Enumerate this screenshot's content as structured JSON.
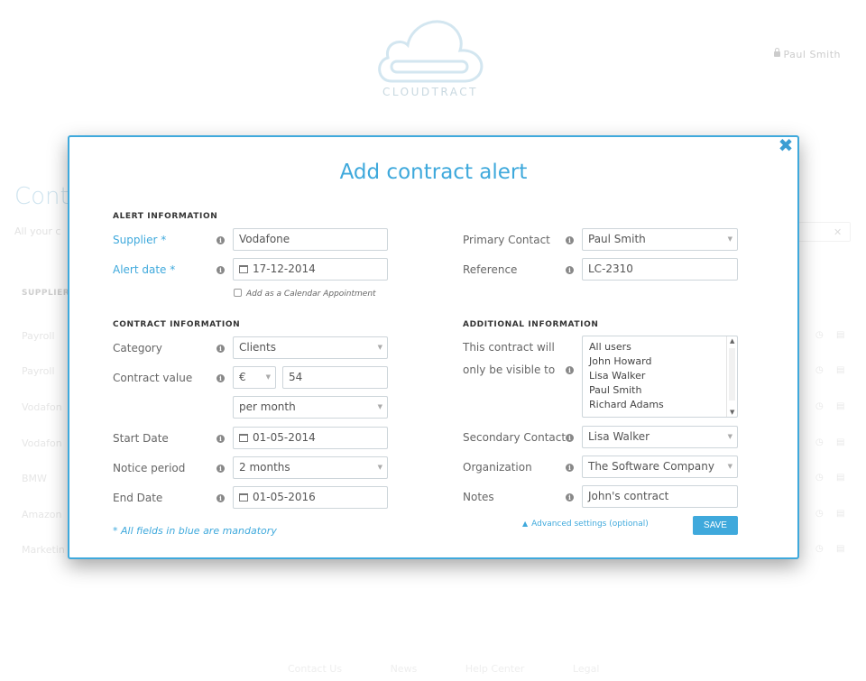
{
  "app": {
    "name": "CLOUDTRACT",
    "user": "Paul Smith"
  },
  "background": {
    "page_title": "Cont",
    "page_sub": "All your c",
    "column": "SUPPLIER",
    "rows": [
      "Payroll",
      "Payroll",
      "Vodafon",
      "Vodafon",
      "BMW",
      "Amazon",
      "Marketin"
    ],
    "footer": [
      "Contact Us",
      "News",
      "Help Center",
      "Legal"
    ]
  },
  "modal": {
    "title": "Add contract alert",
    "sections": {
      "alert": "ALERT INFORMATION",
      "contract": "CONTRACT INFORMATION",
      "additional": "ADDITIONAL INFORMATION"
    },
    "fields": {
      "supplier": {
        "label": "Supplier *",
        "value": "Vodafone"
      },
      "alert_date": {
        "label": "Alert date *",
        "value": "17-12-2014"
      },
      "calendar_checkbox": "Add as a Calendar Appointment",
      "category": {
        "label": "Category",
        "value": "Clients"
      },
      "contract_value": {
        "label": "Contract value",
        "currency": "€",
        "amount": "54"
      },
      "period": {
        "value": "per month"
      },
      "start_date": {
        "label": "Start Date",
        "value": "01-05-2014"
      },
      "notice_period": {
        "label": "Notice period",
        "value": "2 months"
      },
      "end_date": {
        "label": "End Date",
        "value": "01-05-2016"
      },
      "primary_contact": {
        "label": "Primary Contact",
        "value": "Paul Smith"
      },
      "reference": {
        "label": "Reference",
        "value": "LC-2310"
      },
      "visibility": {
        "label_line1": "This contract will",
        "label_line2": "only be visible to",
        "options": [
          "All users",
          "John Howard",
          "Lisa Walker",
          "Paul Smith",
          "Richard Adams"
        ]
      },
      "secondary_contact": {
        "label": "Secondary Contact",
        "value": "Lisa Walker"
      },
      "organization": {
        "label": "Organization",
        "value": "The Software Company"
      },
      "notes": {
        "label": "Notes",
        "value": "John's contract"
      }
    },
    "mandatory_note": "* All fields in blue are mandatory",
    "advanced_link": "Advanced settings (optional)",
    "save_label": "SAVE",
    "info_glyph": "i"
  },
  "icons": {
    "close": "close-icon",
    "calendar": "calendar-icon",
    "info": "info-icon",
    "lock": "lock-icon",
    "logo": "cloud-logo-icon"
  },
  "colors": {
    "accent": "#3fa9dc",
    "border": "#cdd5da"
  }
}
